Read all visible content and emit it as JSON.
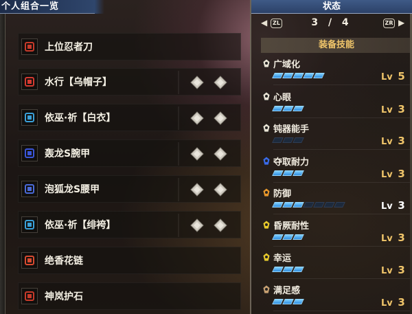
{
  "left_panel": {
    "title": "个人组合一览",
    "items": [
      {
        "name": "上位忍者刀",
        "icon": "weapon-icon",
        "icon_color": "#c63a2a",
        "slots": []
      },
      {
        "name": "水行【乌帽子】",
        "icon": "helm-icon",
        "icon_color": "#d43a30",
        "slots": [
          "empty",
          "empty"
        ]
      },
      {
        "name": "依巫·祈【白衣】",
        "icon": "chest-icon",
        "icon_color": "#3aa0d8",
        "slots": [
          "empty",
          "empty"
        ]
      },
      {
        "name": "轰龙S腕甲",
        "icon": "arm-icon",
        "icon_color": "#3a55d8",
        "slots": [
          "empty",
          "empty"
        ]
      },
      {
        "name": "泡狐龙S腰甲",
        "icon": "waist-icon",
        "icon_color": "#4a6ad8",
        "slots": [
          "empty",
          "empty"
        ]
      },
      {
        "name": "依巫·祈【绯袴】",
        "icon": "legs-icon",
        "icon_color": "#3aa0d8",
        "slots": [
          "empty",
          "empty"
        ]
      },
      {
        "name": "绝香花链",
        "icon": "petalace-icon",
        "icon_color": "#d84a30",
        "slots": []
      },
      {
        "name": "神岚护石",
        "icon": "talisman-icon",
        "icon_color": "#c63a2a",
        "slots": []
      }
    ]
  },
  "right_panel": {
    "title": "状态",
    "pager": {
      "left_button": "ZL",
      "right_button": "ZR",
      "page_text": "3 / 4",
      "current": 3,
      "total": 4
    },
    "section_title": "装备技能",
    "skills": [
      {
        "name": "广域化",
        "lv_label": "Lv",
        "level": 5,
        "max": 5,
        "lv_text": "5",
        "icon_color": "#e8e2d3"
      },
      {
        "name": "心眼",
        "lv_label": "Lv",
        "level": 3,
        "max": 3,
        "lv_text": "3",
        "icon_color": "#e8e2d3"
      },
      {
        "name": "钝器能手",
        "lv_label": "Lv",
        "level": 0,
        "max": 3,
        "lv_text": "3",
        "icon_color": "#e8e2d3"
      },
      {
        "name": "夺取耐力",
        "lv_label": "Lv",
        "level": 3,
        "max": 3,
        "lv_text": "3",
        "icon_color": "#3a6ae8"
      },
      {
        "name": "防御",
        "lv_label": "Lv",
        "level": 3,
        "max": 7,
        "lv_text": "3",
        "icon_color": "#e8962a"
      },
      {
        "name": "昏厥耐性",
        "lv_label": "Lv",
        "level": 3,
        "max": 3,
        "lv_text": "3",
        "icon_color": "#e8c82a"
      },
      {
        "name": "幸运",
        "lv_label": "Lv",
        "level": 3,
        "max": 3,
        "lv_text": "3",
        "icon_color": "#e8c82a"
      },
      {
        "name": "满足感",
        "lv_label": "Lv",
        "level": 3,
        "max": 3,
        "lv_text": "3",
        "icon_color": "#c8a070"
      }
    ]
  },
  "colors": {
    "header_blue": "#2f466c",
    "level_gold": "#f0c56a",
    "bar_blue": "#2f8de0"
  }
}
